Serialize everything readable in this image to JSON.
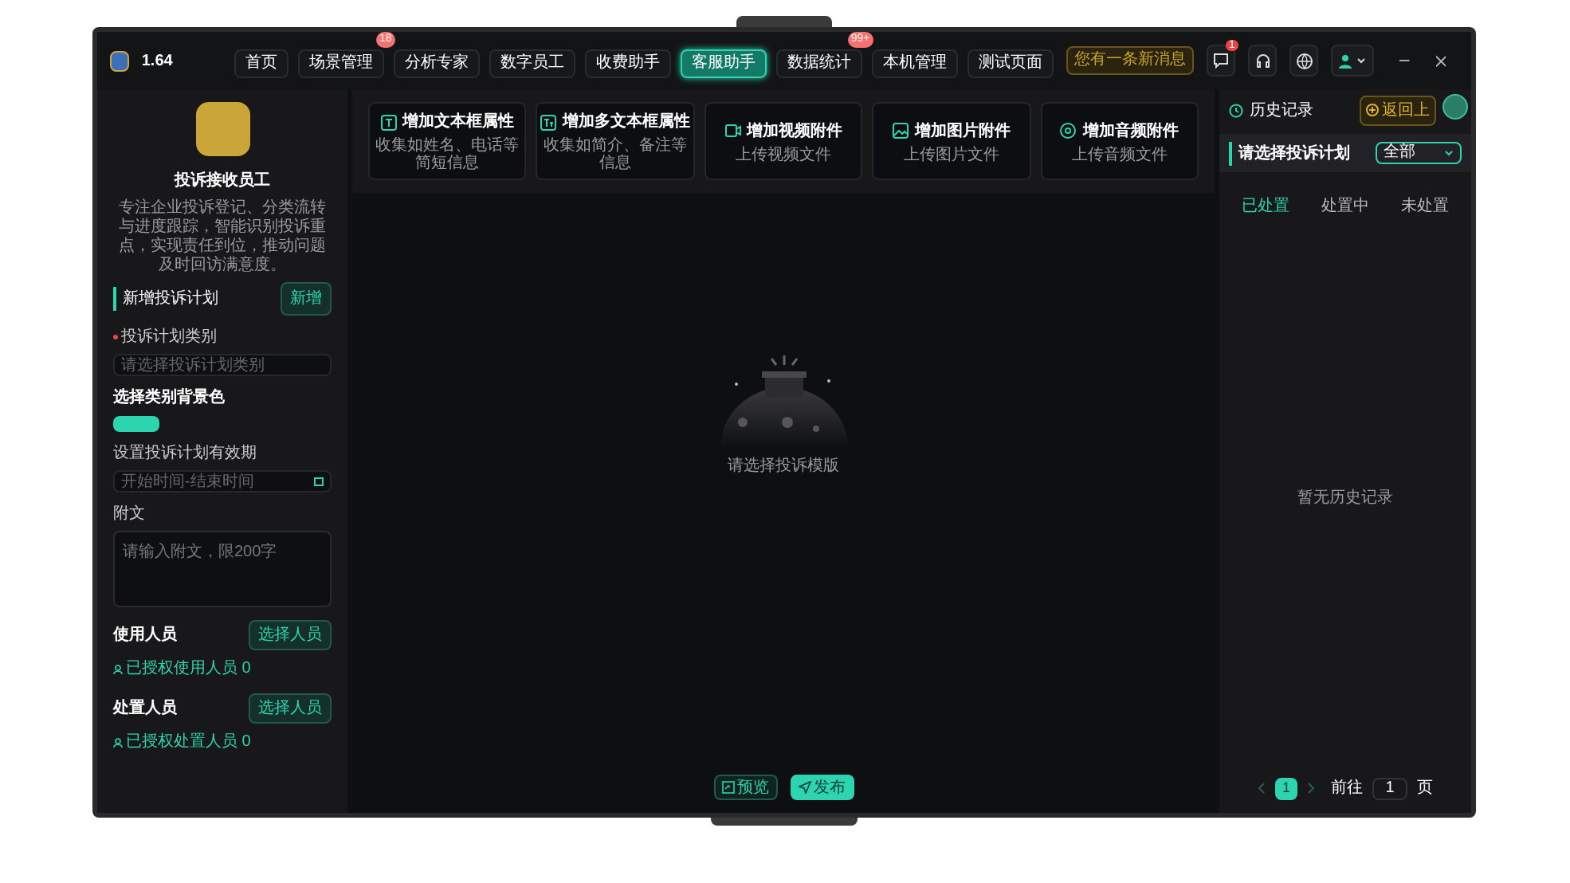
{
  "app": {
    "version": "1.64"
  },
  "nav": [
    {
      "label": "首页",
      "selected": false
    },
    {
      "label": "场景管理",
      "selected": false,
      "badge": "18"
    },
    {
      "label": "分析专家",
      "selected": false
    },
    {
      "label": "数字员工",
      "selected": false
    },
    {
      "label": "收费助手",
      "selected": false
    },
    {
      "label": "客服助手",
      "selected": true
    },
    {
      "label": "数据统计",
      "selected": false,
      "badge": "99+"
    },
    {
      "label": "本机管理",
      "selected": false
    },
    {
      "label": "测试页面",
      "selected": false
    }
  ],
  "header": {
    "notice": "您有一条新消息",
    "message_badge": "1"
  },
  "left": {
    "title": "投诉接收员工",
    "description": "专注企业投诉登记、分类流转与进度跟踪，智能识别投诉重点，实现责任到位，推动问题及时回访满意度。",
    "section_title": "新增投诉计划",
    "add_button": "新增",
    "fields": [
      {
        "kind": "select",
        "label": "投诉计划类别",
        "required": true,
        "placeholder": "请选择投诉计划类别"
      },
      {
        "kind": "color",
        "label": "选择类别背景色",
        "required": false,
        "color": "#2dd4b0"
      },
      {
        "kind": "daterange",
        "label": "设置投诉计划有效期",
        "required": false,
        "placeholder": "开始时间-结束时间"
      },
      {
        "kind": "textarea",
        "label": "附文",
        "required": false,
        "placeholder": "请输入附文，限200字"
      }
    ],
    "people": [
      {
        "title": "使用人员",
        "button": "选择人员",
        "authorized": "已授权使用人员 0"
      },
      {
        "title": "处置人员",
        "button": "选择人员",
        "authorized": "已授权处置人员 0"
      }
    ]
  },
  "cards": [
    {
      "kind": "text",
      "title": "增加文本框属性",
      "subtitle": "收集如姓名、电话等简短信息"
    },
    {
      "kind": "multitext",
      "title": "增加多文本框属性",
      "subtitle": "收集如简介、备注等信息"
    },
    {
      "kind": "video",
      "title": "增加视频附件",
      "subtitle": "上传视频文件"
    },
    {
      "kind": "image",
      "title": "增加图片附件",
      "subtitle": "上传图片文件"
    },
    {
      "kind": "audio",
      "title": "增加音频附件",
      "subtitle": "上传音频文件"
    }
  ],
  "empty": {
    "text": "请选择投诉模版"
  },
  "actions": [
    {
      "kind": "outline",
      "label": "预览"
    },
    {
      "kind": "primary",
      "label": "发布"
    }
  ],
  "history": {
    "title": "历史记录",
    "back_button": "返回上",
    "filter_title": "请选择投诉计划",
    "filter_value": "全部",
    "tabs": [
      {
        "label": "已处置",
        "selected": true
      },
      {
        "label": "处置中",
        "selected": false
      },
      {
        "label": "未处置",
        "selected": false
      }
    ],
    "empty": "暂无历史记录",
    "pagination": {
      "pages": [
        {
          "label": "1",
          "selected": true
        }
      ],
      "goto_label": "前往",
      "goto_value": "1",
      "page_suffix": "页"
    }
  }
}
